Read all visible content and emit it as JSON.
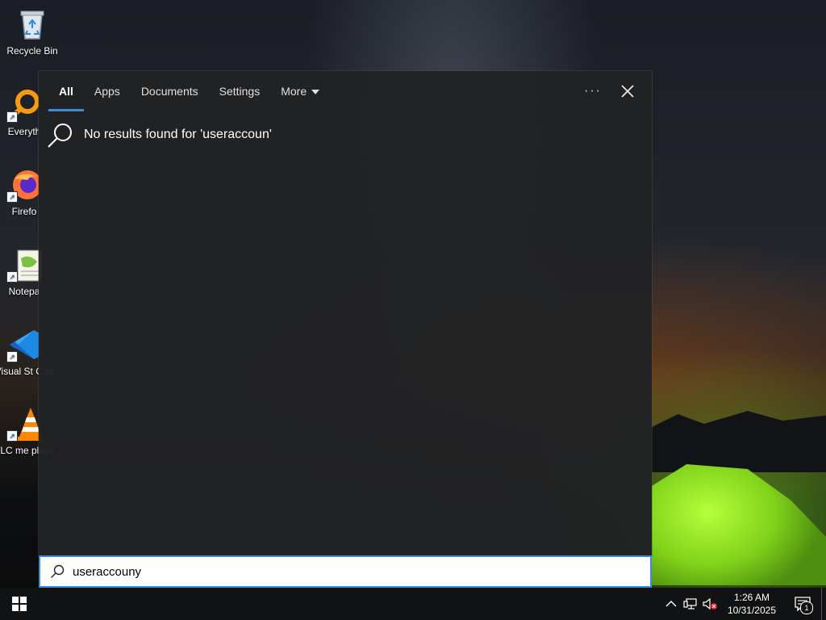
{
  "desktop": {
    "icons": [
      {
        "label": "Recycle Bin",
        "icon": "recycle-bin-icon"
      },
      {
        "label": "Everyth",
        "icon": "everything-search-icon"
      },
      {
        "label": "Firefo",
        "icon": "firefox-icon"
      },
      {
        "label": "Notepa",
        "icon": "notepad-plus-plus-icon"
      },
      {
        "label": "Visual St Cod",
        "icon": "vscode-icon"
      },
      {
        "label": "VLC me playe",
        "icon": "vlc-icon"
      }
    ]
  },
  "search": {
    "tabs": [
      {
        "label": "All",
        "active": true
      },
      {
        "label": "Apps",
        "active": false
      },
      {
        "label": "Documents",
        "active": false
      },
      {
        "label": "Settings",
        "active": false
      },
      {
        "label": "More",
        "active": false
      }
    ],
    "ellipsis": "···",
    "result_message": "No results found for 'useraccoun'",
    "query": "useraccouny",
    "accent": "#3b8fd8"
  },
  "taskbar": {
    "time": "1:26 AM",
    "date": "10/31/2025",
    "notification_count": "1"
  }
}
